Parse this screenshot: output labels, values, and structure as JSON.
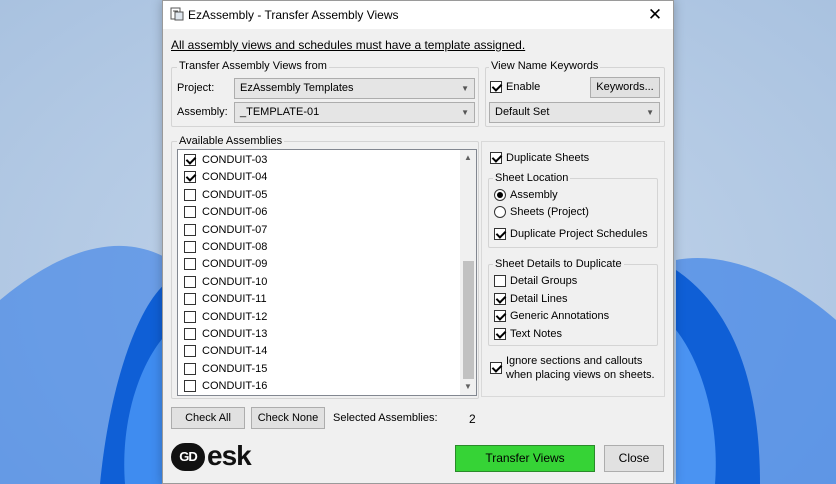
{
  "window": {
    "title": "EzAssembly - Transfer Assembly Views",
    "close_glyph": "✕"
  },
  "notice": "All assembly views and schedules must have a template assigned.",
  "transfer_from": {
    "group_label": "Transfer Assembly Views from",
    "project_label": "Project:",
    "project_value": "EzAssembly Templates",
    "assembly_label": "Assembly:",
    "assembly_value": "_TEMPLATE-01"
  },
  "keywords": {
    "group_label": "View Name Keywords",
    "enable_label": "Enable",
    "enable_checked": true,
    "keywords_button": "Keywords...",
    "set_value": "Default Set"
  },
  "assemblies": {
    "group_label": "Available Assemblies",
    "items": [
      {
        "name": "CONDUIT-03",
        "checked": true
      },
      {
        "name": "CONDUIT-04",
        "checked": true
      },
      {
        "name": "CONDUIT-05",
        "checked": false
      },
      {
        "name": "CONDUIT-06",
        "checked": false
      },
      {
        "name": "CONDUIT-07",
        "checked": false
      },
      {
        "name": "CONDUIT-08",
        "checked": false
      },
      {
        "name": "CONDUIT-09",
        "checked": false
      },
      {
        "name": "CONDUIT-10",
        "checked": false
      },
      {
        "name": "CONDUIT-11",
        "checked": false
      },
      {
        "name": "CONDUIT-12",
        "checked": false
      },
      {
        "name": "CONDUIT-13",
        "checked": false
      },
      {
        "name": "CONDUIT-14",
        "checked": false
      },
      {
        "name": "CONDUIT-15",
        "checked": false
      },
      {
        "name": "CONDUIT-16",
        "checked": false
      }
    ]
  },
  "options": {
    "duplicate_sheets_label": "Duplicate Sheets",
    "duplicate_sheets_checked": true,
    "sheet_location": {
      "group_label": "Sheet Location",
      "assembly_label": "Assembly",
      "assembly_selected": true,
      "sheets_project_label": "Sheets (Project)",
      "sheets_project_selected": false,
      "duplicate_schedules_label": "Duplicate Project Schedules",
      "duplicate_schedules_checked": true
    },
    "sheet_details": {
      "group_label": "Sheet Details to Duplicate",
      "items": [
        {
          "label": "Detail Groups",
          "checked": false
        },
        {
          "label": "Detail Lines",
          "checked": true
        },
        {
          "label": "Generic Annotations",
          "checked": true
        },
        {
          "label": "Text Notes",
          "checked": true
        }
      ]
    },
    "ignore_sections_line1": "Ignore sections and callouts",
    "ignore_sections_line2": "when placing views on sheets.",
    "ignore_sections_checked": true
  },
  "footer": {
    "check_all": "Check All",
    "check_none": "Check None",
    "selected_label": "Selected Assemblies:",
    "selected_count": "2",
    "logo_text": "esk",
    "logo_mark": "GD",
    "transfer_button": "Transfer Views",
    "close_button": "Close"
  },
  "colors": {
    "transfer_green": "#36d336",
    "dialog_bg": "#f0f0f0",
    "wallpaper_blue": "#1f6fe0"
  }
}
